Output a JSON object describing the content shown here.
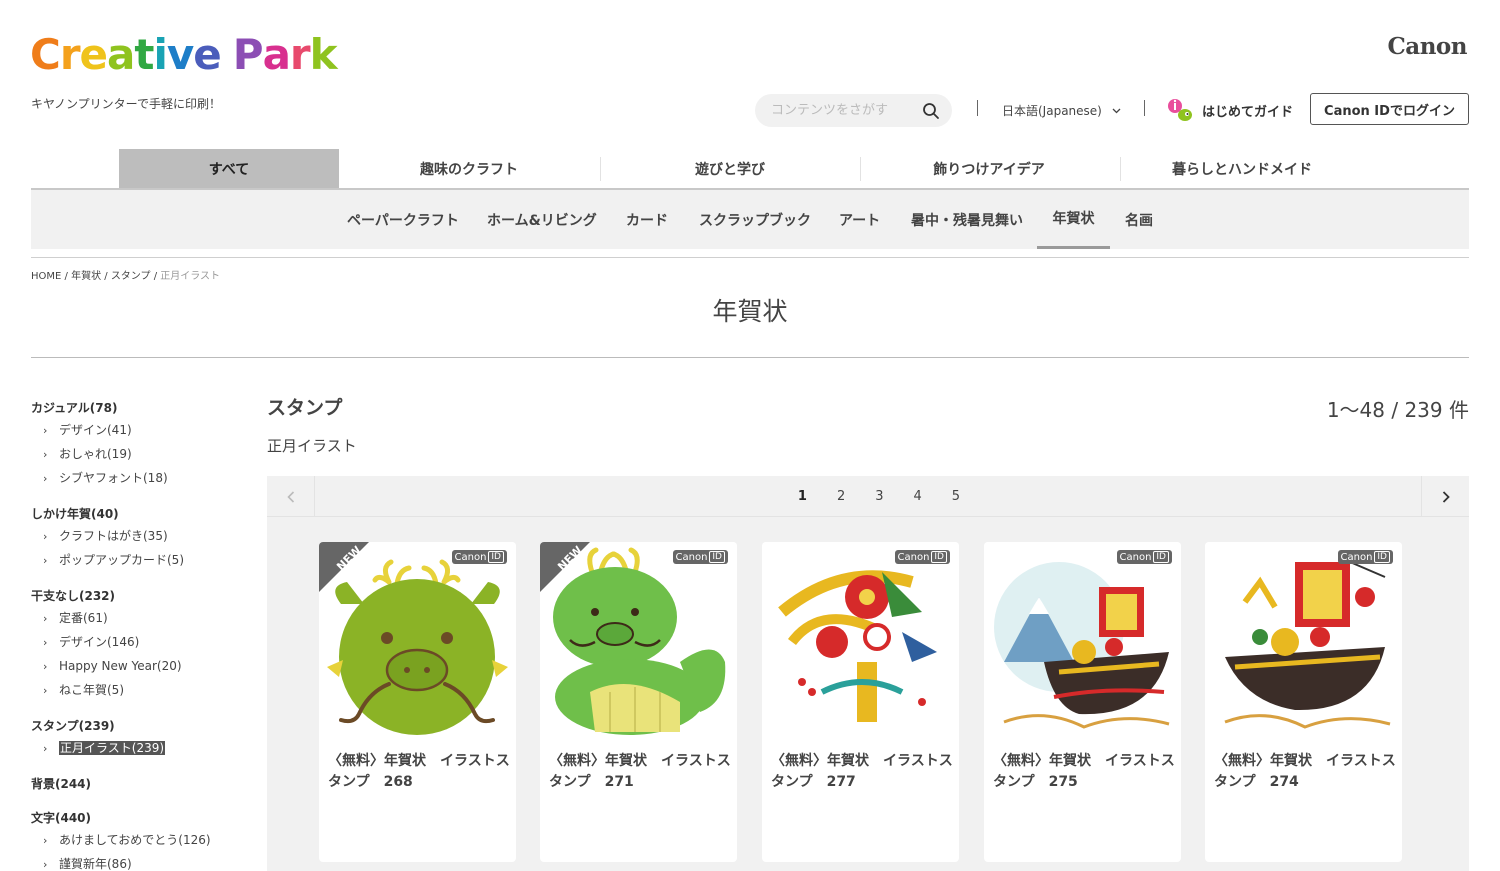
{
  "header": {
    "logo_letters": [
      {
        "ch": "C",
        "color": "#ef7d1a"
      },
      {
        "ch": "r",
        "color": "#f4a11c"
      },
      {
        "ch": "e",
        "color": "#efc31b"
      },
      {
        "ch": "a",
        "color": "#8fc31f"
      },
      {
        "ch": "t",
        "color": "#31a843"
      },
      {
        "ch": "i",
        "color": "#1aa3b4"
      },
      {
        "ch": "v",
        "color": "#1e7ec8"
      },
      {
        "ch": "e",
        "color": "#4b5dbb"
      },
      {
        "ch": " ",
        "color": "#ffffff"
      },
      {
        "ch": "P",
        "color": "#8c4eb4"
      },
      {
        "ch": "a",
        "color": "#d8308f"
      },
      {
        "ch": "r",
        "color": "#e84a6d"
      },
      {
        "ch": "k",
        "color": "#8fc31f"
      }
    ],
    "tagline": "キヤノンプリンターで手軽に印刷！",
    "brand": "Canon",
    "search_placeholder": "コンテンツをさがす",
    "language": "日本語(Japanese)",
    "guide": "はじめてガイド",
    "login": "Canon IDでログイン"
  },
  "main_nav": [
    "すべて",
    "趣味のクラフト",
    "遊びと学び",
    "飾りつけアイデア",
    "暮らしとハンドメイド"
  ],
  "sub_nav": [
    "ペーパークラフト",
    "ホーム&リビング",
    "カード",
    "スクラップブック",
    "アート",
    "暑中・残暑見舞い",
    "年賀状",
    "名画"
  ],
  "breadcrumb": {
    "home": "HOME",
    "l1": "年賀状",
    "l2": "スタンプ",
    "current": "正月イラスト",
    "sep": " / "
  },
  "page_title": "年賀状",
  "sidebar": [
    {
      "label": "カジュアル(78)",
      "children": [
        "デザイン(41)",
        "おしゃれ(19)",
        "シブヤフォント(18)"
      ]
    },
    {
      "label": "しかけ年賀(40)",
      "children": [
        "クラフトはがき(35)",
        "ポップアップカード(5)"
      ]
    },
    {
      "label": "干支なし(232)",
      "children": [
        "定番(61)",
        "デザイン(146)",
        "Happy New Year(20)",
        "ねこ年賀(5)"
      ]
    },
    {
      "label": "スタンプ(239)",
      "children": [
        "正月イラスト(239)"
      ]
    },
    {
      "label": "背景(244)",
      "children": []
    },
    {
      "label": "文字(440)",
      "children": [
        "あけましておめでとう(126)",
        "謹賀新年(86)"
      ]
    }
  ],
  "content": {
    "section_title": "スタンプ",
    "count": "1〜48 / 239 件",
    "subtitle": "正月イラスト",
    "pages": [
      "1",
      "2",
      "3",
      "4",
      "5"
    ],
    "badge_text": "Canon",
    "badge_id": "ID",
    "new_label": "NEW"
  },
  "cards": [
    {
      "title": "〈無料〉年賀状　イラストスタンプ　268",
      "new": true
    },
    {
      "title": "〈無料〉年賀状　イラストスタンプ　271",
      "new": true
    },
    {
      "title": "〈無料〉年賀状　イラストスタンプ　277",
      "new": false
    },
    {
      "title": "〈無料〉年賀状　イラストスタンプ　275",
      "new": false
    },
    {
      "title": "〈無料〉年賀状　イラストスタンプ　274",
      "new": false
    }
  ],
  "icons": {
    "search": "search-icon",
    "chevron": "chevron-down-icon",
    "guide": "guide-icon",
    "prev": "chevron-left-icon",
    "next": "chevron-right-icon"
  }
}
